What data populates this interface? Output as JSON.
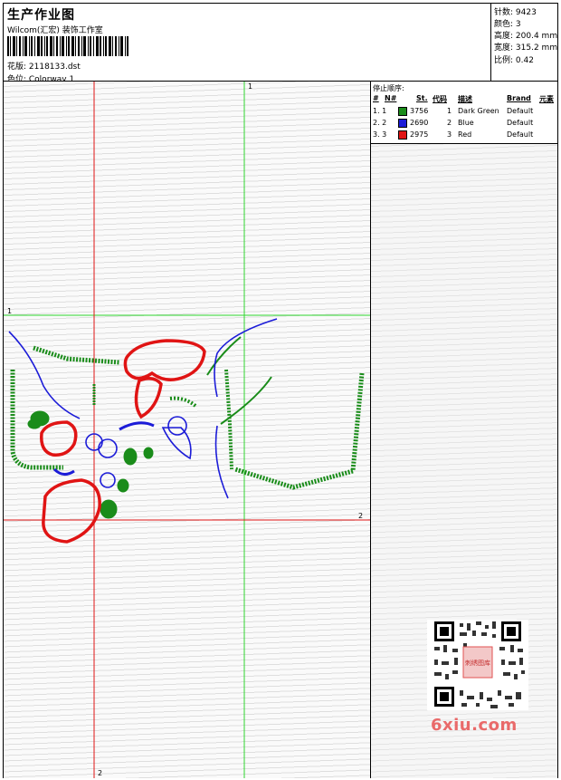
{
  "header": {
    "title": "生产作业图",
    "subtitle": "Wilcom(汇宏) 装饰工作室",
    "file_line": "花版: 2118133.dst",
    "colorway_line": "色位: Colorway 1"
  },
  "stats": [
    {
      "label": "针数",
      "value": "9423"
    },
    {
      "label": "颜色",
      "value": "3"
    },
    {
      "label": "高度",
      "value": "200.4 mm"
    },
    {
      "label": "宽度",
      "value": "315.2 mm"
    },
    {
      "label": "比例",
      "value": "0.42"
    }
  ],
  "guides": {
    "v1": "1",
    "h1": "1",
    "v2": "2",
    "h2": "2"
  },
  "sequence": {
    "title": "停止顺序:",
    "headers": {
      "hash": "#",
      "n": "N#",
      "st": "St.",
      "code": "代码",
      "desc": "描述",
      "brand": "Brand",
      "element": "元素"
    },
    "rows": [
      {
        "idx": "1. 1",
        "color": "#1a8c1a",
        "st": "3756",
        "code": "1",
        "desc": "Dark Green",
        "brand": "Default"
      },
      {
        "idx": "2. 2",
        "color": "#1c1cd8",
        "st": "2690",
        "code": "2",
        "desc": "Blue",
        "brand": "Default"
      },
      {
        "idx": "3. 3",
        "color": "#e01414",
        "st": "2975",
        "code": "3",
        "desc": "Red",
        "brand": "Default"
      }
    ]
  },
  "thread_colors": {
    "green": "#1a8c1a",
    "blue": "#1c1cd8",
    "red": "#e01414"
  },
  "qr_caption": "刺绣图库",
  "watermark": "6xiu.com"
}
